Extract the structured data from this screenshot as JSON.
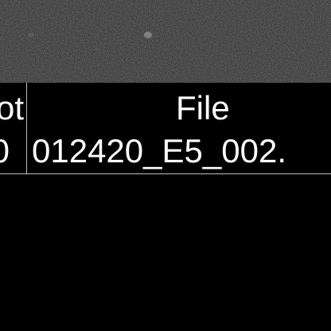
{
  "image_panel": {
    "description_icon": "sem-micrograph-image"
  },
  "info_bar": {
    "left_column": {
      "header_fragment": "ot",
      "value_fragment": "0"
    },
    "file_column": {
      "header": "File",
      "value": "012420_E5_002."
    }
  },
  "colors": {
    "background": "#000000",
    "text": "#ffffff",
    "divider": "#bdbdbd",
    "micrograph_base": "#2a2a2a"
  }
}
